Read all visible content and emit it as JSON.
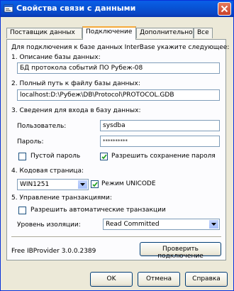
{
  "window": {
    "title": "Свойства связи с данными",
    "icon": "datalink-icon"
  },
  "tabs": [
    {
      "label": "Поставщик данных",
      "active": false
    },
    {
      "label": "Подключение",
      "active": true
    },
    {
      "label": "Дополнительно",
      "active": false
    },
    {
      "label": "Все",
      "active": false
    }
  ],
  "connection": {
    "intro": "Для подключения к базе данных InterBase укажите следующее:",
    "section1_label": "1. Описание базы данных:",
    "description_value": "БД протокола событий ПО Рубеж-08",
    "section2_label": "2. Полный путь к файлу базы данных:",
    "path_value": "localhost:D:\\Рубеж\\DB\\Protocol\\PROTOCOL.GDB",
    "section3_label": "3. Сведения для входа в базу данных:",
    "user_label": "Пользователь:",
    "user_value": "sysdba",
    "password_label": "Пароль:",
    "password_value": "**********",
    "empty_password_label": "Пустой пароль",
    "empty_password_checked": false,
    "allow_save_label": "Разрешить сохранение пароля",
    "allow_save_checked": true,
    "section4_label": "4. Кодовая страница:",
    "codepage_value": "WIN1251",
    "unicode_label": "Режим UNICODE",
    "unicode_checked": true,
    "section5_label": "5. Управление транзакциями:",
    "auto_tx_label": "Разрешить автоматические транзакции",
    "auto_tx_checked": false,
    "isolation_label": "Уровень изоляции:",
    "isolation_value": "Read Committed",
    "provider_version": "Free IBProvider 3.0.0.2389",
    "test_button": "Проверить подключение"
  },
  "buttons": {
    "ok": "OK",
    "cancel": "Отмена",
    "help": "Справка"
  }
}
